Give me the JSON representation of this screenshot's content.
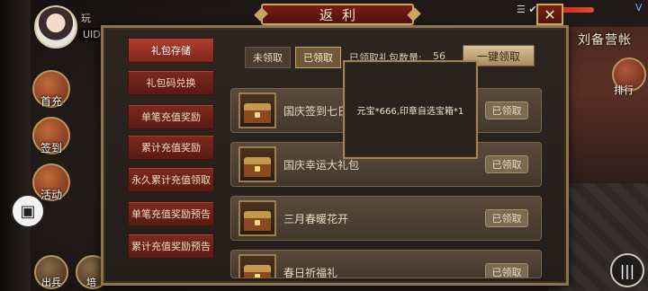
{
  "player": {
    "name_fragment": "玩",
    "uid_label": "UID"
  },
  "side_menu": {
    "first_charge": "首充",
    "sign_in": "签到",
    "event": "活动"
  },
  "bottom_menu": {
    "dispatch": "出兵",
    "train": "培"
  },
  "right_panel": {
    "camp_title": "刘备营帐",
    "rank": "排行",
    "vip": "V"
  },
  "dialog": {
    "title": "返利",
    "close_icon": "close-icon",
    "tabs": [
      {
        "label": "礼包存储",
        "active": true
      },
      {
        "label": "礼包码兑换",
        "active": false
      },
      {
        "label": "单笔充值奖励",
        "active": false
      },
      {
        "label": "累计充值奖励",
        "active": false
      },
      {
        "label": "永久累计充值领取",
        "active": false
      },
      {
        "label": "单笔充值奖励预告",
        "active": false
      },
      {
        "label": "累计充值奖励预告",
        "active": false
      }
    ],
    "filters": {
      "unclaimed": "未领取",
      "claimed": "已领取"
    },
    "claimed_count_label": "已领取礼包数量:",
    "claimed_count": "56",
    "claim_all": "一键领取",
    "rows": [
      {
        "name": "国庆签到七日",
        "status": "已领取"
      },
      {
        "name": "国庆幸运大礼包",
        "status": "已领取"
      },
      {
        "name": "三月春暖花开",
        "status": "已领取"
      },
      {
        "name": "春日祈福礼",
        "status": "已领取"
      }
    ],
    "tooltip": "元宝*666,印章自选宝箱*1"
  },
  "colors": {
    "tab_active": "#b04030",
    "tab": "#7e2a1e",
    "frame_gold": "#c9a561"
  }
}
